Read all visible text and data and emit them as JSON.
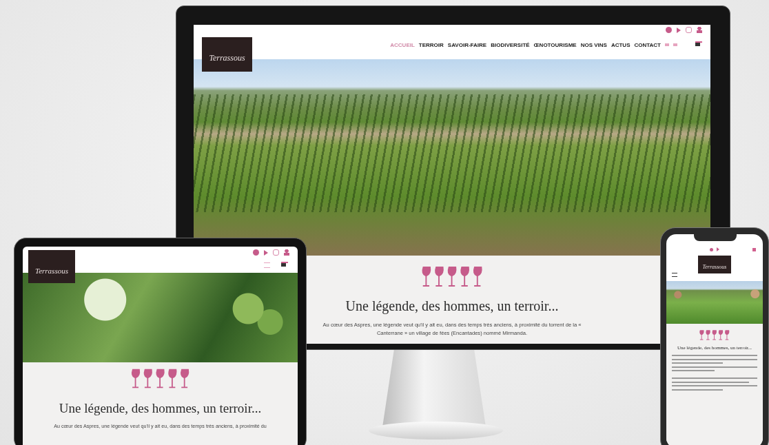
{
  "desktop": {
    "logo": "Terrassous",
    "nav": [
      {
        "label": "ACCUEIL",
        "selected": true
      },
      {
        "label": "TERROIR",
        "selected": false
      },
      {
        "label": "SAVOIR-FAIRE",
        "selected": false
      },
      {
        "label": "BIODIVERSITÉ",
        "selected": false
      },
      {
        "label": "ŒNOTOURISME",
        "selected": false
      },
      {
        "label": "NOS VINS",
        "selected": false
      },
      {
        "label": "ACTUS",
        "selected": false
      },
      {
        "label": "CONTACT",
        "selected": false
      }
    ],
    "heading": "Une légende, des hommes, un terroir...",
    "paragraph": "Au cœur des Aspres, une légende veut qu'il y ait eu, dans des temps très anciens, à proximité du torrent de la « Canterrane » un village de fées (Encantades) nommé Mirmanda."
  },
  "tablet": {
    "logo": "Terrassous",
    "heading": "Une légende, des hommes, un terroir...",
    "paragraph": "Au cœur des Aspres, une légende veut qu'il y ait eu, dans des temps très anciens, à proximité du"
  },
  "phone": {
    "logo": "Terrassous",
    "heading": "Une légende, des hommes, un terroir..."
  }
}
